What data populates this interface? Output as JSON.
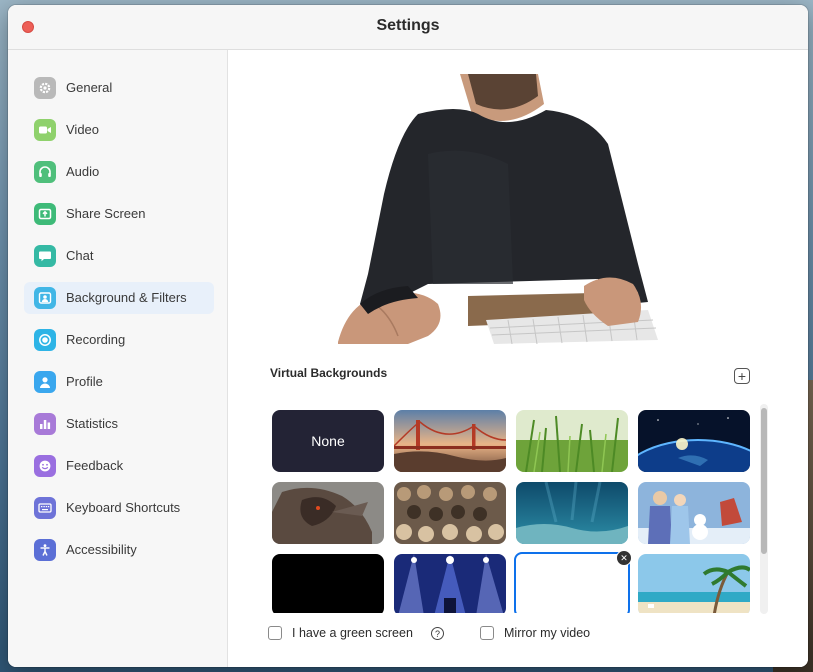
{
  "window": {
    "title": "Settings"
  },
  "sidebar": {
    "items": [
      {
        "label": "General",
        "icon": "gear-icon",
        "color": "#b9b9b9",
        "active": false
      },
      {
        "label": "Video",
        "icon": "video-camera-icon",
        "color": "#8fd16c",
        "active": false
      },
      {
        "label": "Audio",
        "icon": "headphones-icon",
        "color": "#4fbf7b",
        "active": false
      },
      {
        "label": "Share Screen",
        "icon": "share-screen-icon",
        "color": "#3eba78",
        "active": false
      },
      {
        "label": "Chat",
        "icon": "chat-bubble-icon",
        "color": "#35b9a4",
        "active": false
      },
      {
        "label": "Background & Filters",
        "icon": "person-portrait-icon",
        "color": "#41b6e6",
        "active": true
      },
      {
        "label": "Recording",
        "icon": "record-icon",
        "color": "#2eb4e6",
        "active": false
      },
      {
        "label": "Profile",
        "icon": "profile-icon",
        "color": "#3aa7ee",
        "active": false
      },
      {
        "label": "Statistics",
        "icon": "bar-chart-icon",
        "color": "#a87ad8",
        "active": false
      },
      {
        "label": "Feedback",
        "icon": "smiley-icon",
        "color": "#9a6fe0",
        "active": false
      },
      {
        "label": "Keyboard Shortcuts",
        "icon": "keyboard-icon",
        "color": "#6e73d8",
        "active": false
      },
      {
        "label": "Accessibility",
        "icon": "accessibility-icon",
        "color": "#5b6fd6",
        "active": false
      }
    ]
  },
  "main": {
    "section_title": "Virtual Backgrounds",
    "backgrounds": [
      {
        "name": "none",
        "label": "None"
      },
      {
        "name": "golden-gate-bridge"
      },
      {
        "name": "grass"
      },
      {
        "name": "earth-from-space"
      },
      {
        "name": "fantasy-creature"
      },
      {
        "name": "cats-crowd"
      },
      {
        "name": "underwater"
      },
      {
        "name": "frozen-characters"
      },
      {
        "name": "black"
      },
      {
        "name": "concert-lights"
      },
      {
        "name": "blank-selected"
      },
      {
        "name": "beach-palm"
      }
    ],
    "green_screen_label": "I have a green screen",
    "mirror_label": "Mirror my video",
    "help_symbol": "?",
    "add_symbol": "+",
    "remove_symbol": "✕"
  },
  "colors": {
    "accent": "#0e71eb",
    "active_nav_bg": "#e8f0fa",
    "close_button": "#ed5f57"
  }
}
